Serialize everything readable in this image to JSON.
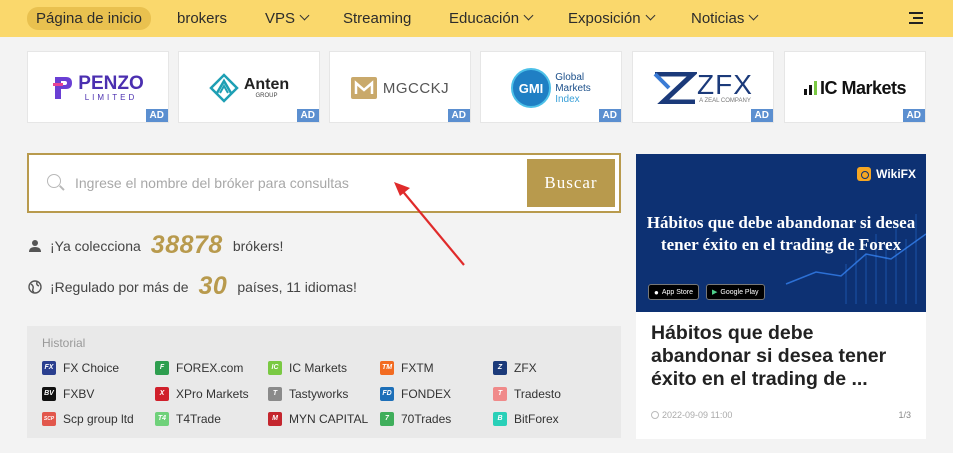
{
  "nav": {
    "items": [
      {
        "label": "Página de inicio"
      },
      {
        "label": "brokers"
      },
      {
        "label": "VPS"
      },
      {
        "label": "Streaming"
      },
      {
        "label": "Educación"
      },
      {
        "label": "Exposición"
      },
      {
        "label": "Noticias"
      }
    ],
    "menu_icon": "hamburger-menu-icon"
  },
  "ads": {
    "badge": "AD",
    "items": [
      {
        "name": "PENZO",
        "sub": "LIMITED"
      },
      {
        "name": "Anten",
        "sub": "GROUP"
      },
      {
        "name": "MGCCKJ"
      },
      {
        "name": "GMI",
        "line1": "Global",
        "line2": "Markets",
        "line3": "Index"
      },
      {
        "name": "ZFX",
        "sub": "A ZEAL COMPANY"
      },
      {
        "name": "IC Markets"
      }
    ]
  },
  "search": {
    "placeholder": "Ingrese el nombre del bróker para consultas",
    "value": "",
    "button_label": "Buscar"
  },
  "stats": {
    "collect_prefix": "¡Ya colecciona",
    "broker_count": "38878",
    "collect_suffix": "brókers!",
    "regulated_prefix": "¡Regulado por más de",
    "country_count": "30",
    "regulated_suffix": "países, 11 idiomas!"
  },
  "history": {
    "title": "Historial",
    "items": [
      {
        "label": "FX Choice",
        "color": "#2a3f8f",
        "icon": "FX"
      },
      {
        "label": "FOREX.com",
        "color": "#2e9e4f",
        "icon": "F"
      },
      {
        "label": "IC Markets",
        "color": "#7ac943",
        "icon": "IC"
      },
      {
        "label": "FXTM",
        "color": "#f26b21",
        "icon": "TM"
      },
      {
        "label": "ZFX",
        "color": "#1b3a7a",
        "icon": "Z"
      },
      {
        "label": "FXBV",
        "color": "#111111",
        "icon": "BV"
      },
      {
        "label": "XPro Markets",
        "color": "#d0202b",
        "icon": "X"
      },
      {
        "label": "Tastyworks",
        "color": "#8a8a8a",
        "icon": "T"
      },
      {
        "label": "FONDEX",
        "color": "#1d6fb8",
        "icon": "FD"
      },
      {
        "label": "Tradesto",
        "color": "#f08a8a",
        "icon": "T"
      },
      {
        "label": "Scp group ltd",
        "color": "#e2574c",
        "icon": "SCP"
      },
      {
        "label": "T4Trade",
        "color": "#6fd17a",
        "icon": "T4"
      },
      {
        "label": "MYN CAPITAL",
        "color": "#c4262e",
        "icon": "M"
      },
      {
        "label": "70Trades",
        "color": "#3fae5b",
        "icon": "7"
      },
      {
        "label": "BitForex",
        "color": "#29d0b8",
        "icon": "B"
      }
    ]
  },
  "card": {
    "brand": "WikiFX",
    "banner_text": "Hábitos que debe abandonar si desea tener éxito en el trading de Forex",
    "app_store": "App Store",
    "google_play": "Google Play",
    "title": "Hábitos que debe abandonar si desea tener éxito en el trading de ...",
    "date": "2022-09-09 11:00",
    "page": "1/3"
  },
  "colors": {
    "nav_bg": "#fad86c",
    "accent_gold": "#b89a4d",
    "ad_badge": "#5b8fd0",
    "banner_bg": "#0d3173",
    "arrow_red": "#e02b2b"
  }
}
